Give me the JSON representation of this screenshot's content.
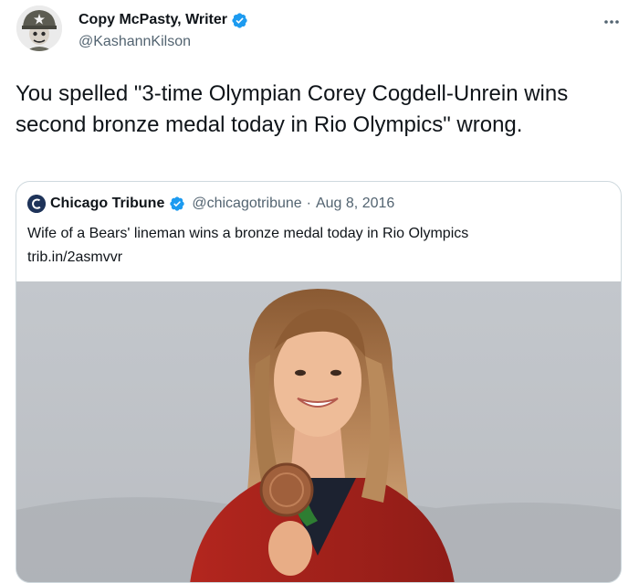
{
  "tweet": {
    "author": {
      "display_name": "Copy McPasty, Writer",
      "handle": "@KashannKilson",
      "verified": true
    },
    "more_label": "···",
    "text": "You spelled \"3-time Olympian Corey Cogdell-Unrein wins second bronze medal today in Rio Olympics\" wrong."
  },
  "quote": {
    "author": {
      "display_name": "Chicago Tribune",
      "handle": "@chicagotribune",
      "verified": true
    },
    "separator": "·",
    "date": "Aug 8, 2016",
    "text": "Wife of a Bears' lineman wins a bronze medal today in Rio Olympics",
    "link": "trib.in/2asmvvr"
  },
  "colors": {
    "accent": "#1d9bf0",
    "text": "#0f1419",
    "secondary_text": "#536471",
    "border": "#cfd9de"
  },
  "icons": {
    "verified": "verified-badge-icon",
    "more": "more-options-icon",
    "tribune_logo": "chicago-tribune-logo-icon"
  }
}
